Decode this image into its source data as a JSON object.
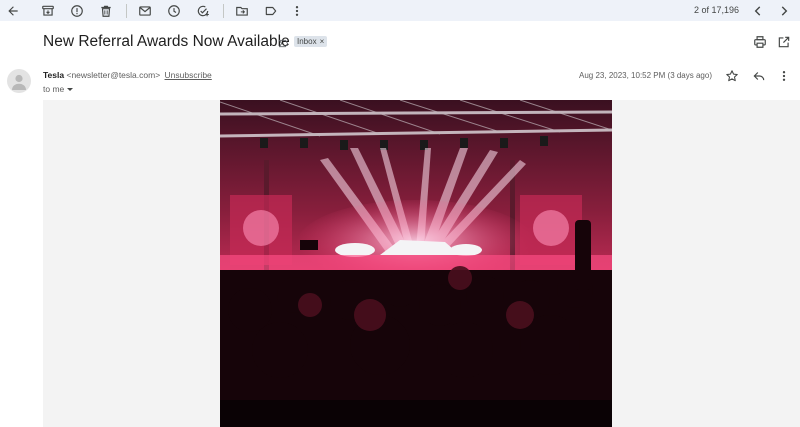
{
  "toolbar": {
    "icons": [
      "back-icon",
      "archive-icon",
      "report-spam-icon",
      "delete-icon",
      "mark-unread-icon",
      "snooze-icon",
      "add-to-tasks-icon",
      "move-to-icon",
      "label-icon",
      "more-icon"
    ],
    "page_count": "2 of 17,196"
  },
  "email": {
    "subject": "New Referral Awards Now Available",
    "label_chip": "Inbox",
    "label_chip_close": "×",
    "sender_name": "Tesla",
    "sender_email": "<newsletter@tesla.com>",
    "unsubscribe": "Unsubscribe",
    "recipient": "to me",
    "date": "Aug 23, 2023, 10:52 PM (3 days ago)"
  },
  "colors": {
    "toolbar_bg": "#eef2f9",
    "body_bg": "#f3f3f3",
    "chip_bg": "#dde3ea",
    "hero_accent": "#ff3f7a"
  }
}
